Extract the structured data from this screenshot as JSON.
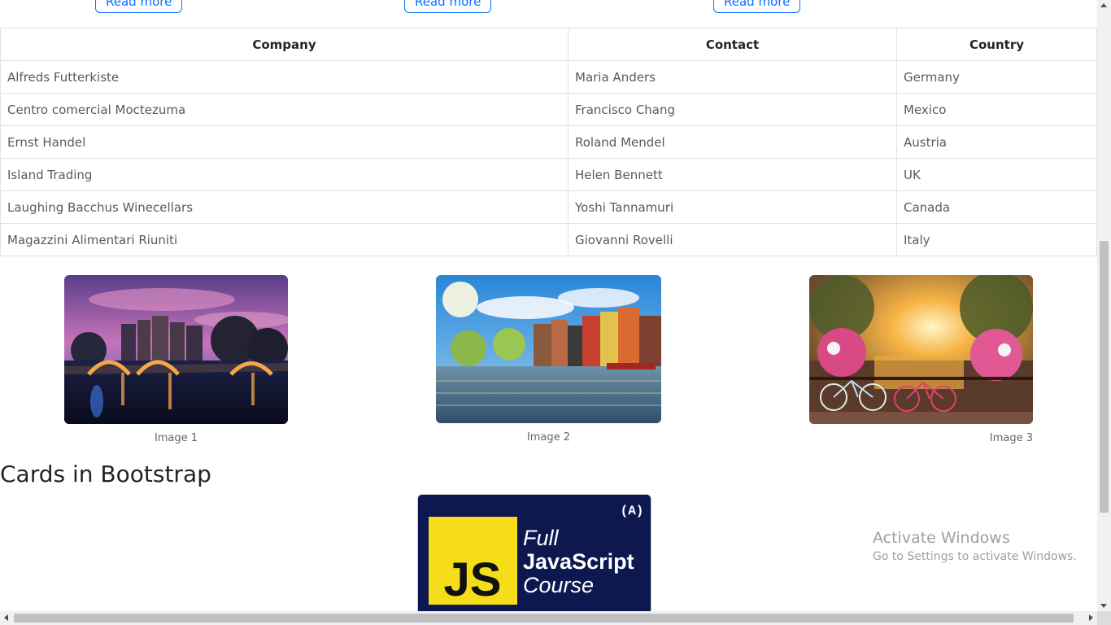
{
  "top_buttons": [
    "Read more",
    "Read more",
    "Read more"
  ],
  "table": {
    "headers": [
      "Company",
      "Contact",
      "Country"
    ],
    "rows": [
      [
        "Alfreds Futterkiste",
        "Maria Anders",
        "Germany"
      ],
      [
        "Centro comercial Moctezuma",
        "Francisco Chang",
        "Mexico"
      ],
      [
        "Ernst Handel",
        "Roland Mendel",
        "Austria"
      ],
      [
        "Island Trading",
        "Helen Bennett",
        "UK"
      ],
      [
        "Laughing Bacchus Winecellars",
        "Yoshi Tannamuri",
        "Canada"
      ],
      [
        "Magazzini Alimentari Riuniti",
        "Giovanni Rovelli",
        "Italy"
      ]
    ]
  },
  "gallery": {
    "captions": [
      "Image 1",
      "Image 2",
      "Image 3"
    ]
  },
  "section": {
    "title": "Cards in Bootstrap"
  },
  "card": {
    "line1": "Full",
    "line2": "JavaScript",
    "line3": "Course",
    "badge": "JS",
    "logo": "(A)"
  },
  "watermark": {
    "line1": "Activate Windows",
    "line2": "Go to Settings to activate Windows."
  },
  "colors": {
    "primary": "#0d6efd",
    "card_bg": "#101a4e",
    "js_yellow": "#f5de19"
  }
}
